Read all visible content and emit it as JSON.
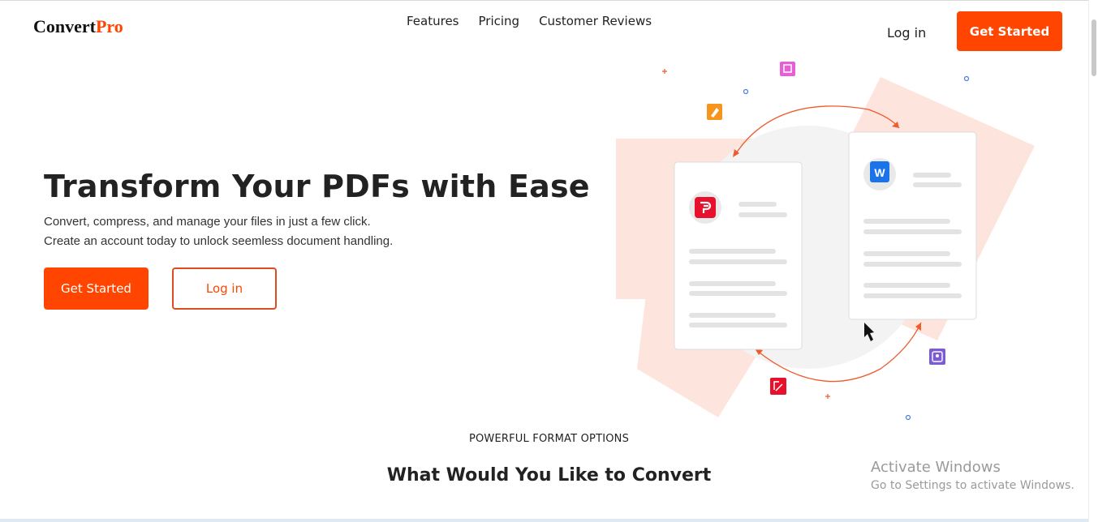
{
  "header": {
    "logo_main": "Convert",
    "logo_accent": "Pro",
    "nav": [
      "Features",
      "Pricing",
      "Customer Reviews"
    ],
    "login_label": "Log in",
    "cta_label": "Get Started"
  },
  "hero": {
    "title": "Transform Your PDFs with Ease",
    "subtitle_line1": "Convert, compress, and manage your files in just a few click.",
    "subtitle_line2": "Create an account today to unlock seemless document handling.",
    "cta_label": "Get Started",
    "login_label": "Log in"
  },
  "illustration": {
    "word_letter": "W",
    "colors": {
      "accent": "#ff4500",
      "peach": "#fde4dc",
      "pdf_red": "#e8112d",
      "word_blue": "#1a73e8"
    }
  },
  "section": {
    "kicker": "POWERFUL FORMAT OPTIONS",
    "title": "What Would You Like to Convert"
  },
  "os_overlay": {
    "line1": "Activate Windows",
    "line2": "Go to Settings to activate Windows."
  }
}
